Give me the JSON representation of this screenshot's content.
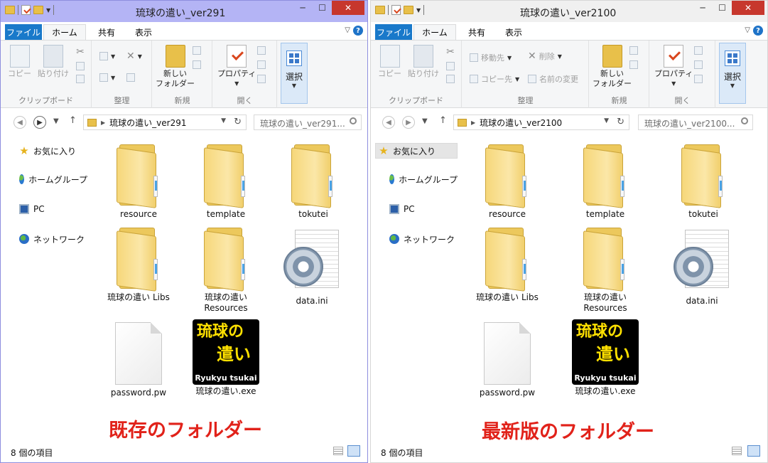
{
  "left_window": {
    "title": "琉球の遣い_ver291",
    "address_path": "琉球の遣い_ver291",
    "search_placeholder": "琉球の遣い_ver291...",
    "annotation": "既存のフォルダー",
    "window_border": "#8e8ede",
    "titlebar_color": "#b4b4f5"
  },
  "right_window": {
    "title": "琉球の遣い_ver2100",
    "address_path": "琉球の遣い_ver2100",
    "search_placeholder": "琉球の遣い_ver2100...",
    "annotation": "最新版のフォルダー",
    "titlebar_color": "#f0f0f0"
  },
  "ribbon_tabs": {
    "file": "ファイル",
    "home": "ホーム",
    "share": "共有",
    "view": "表示"
  },
  "ribbon": {
    "copy": "コピー",
    "paste": "貼り付け",
    "clipboard_group": "クリップボード",
    "organize_group": "整理",
    "move_to": "移動先",
    "delete": "削除",
    "copy_to": "コピー先",
    "rename": "名前の変更",
    "new_folder": "新しい\nフォルダー",
    "new_folder_l1": "新しい",
    "new_folder_l2": "フォルダー",
    "new_group": "新規",
    "properties": "プロパティ",
    "open_group": "開く",
    "select": "選択"
  },
  "nav_pane": {
    "favorites": "お気に入り",
    "homegroup": "ホームグループ",
    "pc": "PC",
    "network": "ネットワーク"
  },
  "files": {
    "resource": "resource",
    "template": "template",
    "tokutei": "tokutei",
    "libs": "琉球の遣い Libs",
    "resources_l1": "琉球の遣い",
    "resources_l2": "Resources",
    "data_ini": "data.ini",
    "password": "password.pw",
    "exe": "琉球の遣い.exe"
  },
  "exe_icon": {
    "line1": "琉球の",
    "line2": "遣い",
    "line3": "Ryukyu tsukai",
    "text_color": "#ffe100"
  },
  "status": {
    "count": "8 個の項目"
  },
  "accent_color": "#1979ca",
  "annotation_color": "#e1221a"
}
